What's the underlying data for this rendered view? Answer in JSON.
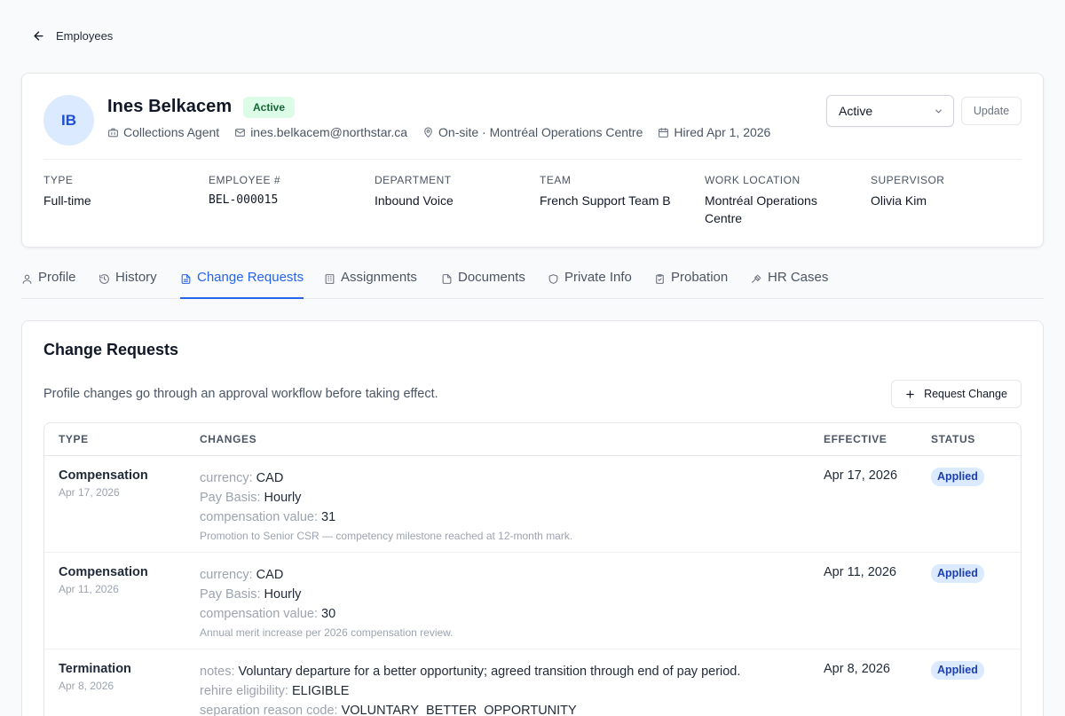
{
  "nav": {
    "back_label": "Employees"
  },
  "employee": {
    "initials": "IB",
    "name": "Ines Belkacem",
    "status_badge": "Active",
    "job_title": "Collections Agent",
    "email": "ines.belkacem@northstar.ca",
    "location": "On-site · Montréal Operations Centre",
    "hired": "Hired Apr 1, 2026",
    "status_select_value": "Active",
    "update_label": "Update"
  },
  "fields": [
    {
      "label": "TYPE",
      "value": "Full-time"
    },
    {
      "label": "EMPLOYEE #",
      "value": "BEL-000015"
    },
    {
      "label": "DEPARTMENT",
      "value": "Inbound Voice"
    },
    {
      "label": "TEAM",
      "value": "French Support Team B"
    },
    {
      "label": "WORK LOCATION",
      "value": "Montréal Operations Centre"
    },
    {
      "label": "SUPERVISOR",
      "value": "Olivia Kim"
    }
  ],
  "tabs": [
    {
      "label": "Profile",
      "icon": "user-icon"
    },
    {
      "label": "History",
      "icon": "history-icon"
    },
    {
      "label": "Change Requests",
      "icon": "document-icon",
      "active": true
    },
    {
      "label": "Assignments",
      "icon": "building-icon"
    },
    {
      "label": "Documents",
      "icon": "file-icon"
    },
    {
      "label": "Private Info",
      "icon": "shield-icon"
    },
    {
      "label": "Probation",
      "icon": "clipboard-icon"
    },
    {
      "label": "HR Cases",
      "icon": "gavel-icon"
    }
  ],
  "change_requests": {
    "title": "Change Requests",
    "description": "Profile changes go through an approval workflow before taking effect.",
    "request_button_label": "Request Change",
    "columns": [
      "TYPE",
      "CHANGES",
      "EFFECTIVE",
      "STATUS"
    ],
    "rows": [
      {
        "type": "Compensation",
        "date": "Apr 17, 2026",
        "changes": [
          {
            "key": "currency:",
            "value": "CAD"
          },
          {
            "key": "Pay Basis:",
            "value": "Hourly"
          },
          {
            "key": "compensation value:",
            "value": "31"
          }
        ],
        "note": "Promotion to Senior CSR — competency milestone reached at 12-month mark.",
        "effective": "Apr 17, 2026",
        "status": "Applied"
      },
      {
        "type": "Compensation",
        "date": "Apr 11, 2026",
        "changes": [
          {
            "key": "currency:",
            "value": "CAD"
          },
          {
            "key": "Pay Basis:",
            "value": "Hourly"
          },
          {
            "key": "compensation value:",
            "value": "30"
          }
        ],
        "note": "Annual merit increase per 2026 compensation review.",
        "effective": "Apr 11, 2026",
        "status": "Applied"
      },
      {
        "type": "Termination",
        "date": "Apr 8, 2026",
        "changes": [
          {
            "key": "notes:",
            "value": "Voluntary departure for a better opportunity; agreed transition through end of pay period."
          },
          {
            "key": "rehire eligibility:",
            "value": "ELIGIBLE"
          },
          {
            "key": "separation reason code:",
            "value": "VOLUNTARY_BETTER_OPPORTUNITY"
          }
        ],
        "note": "",
        "effective": "Apr 8, 2026",
        "status": "Applied"
      }
    ]
  },
  "colors": {
    "accent": "#2563eb",
    "active_badge_bg": "#dcfce7",
    "active_badge_text": "#166534",
    "applied_badge_bg": "#dbeafe",
    "applied_badge_text": "#1e40af"
  }
}
